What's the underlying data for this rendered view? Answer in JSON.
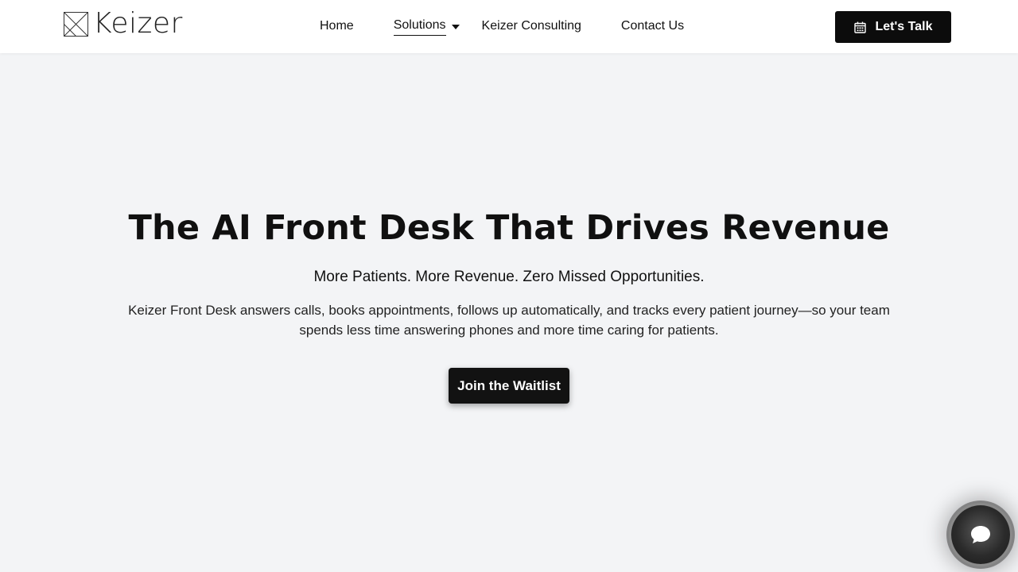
{
  "header": {
    "logo_text": "Keizer",
    "nav": {
      "home": "Home",
      "solutions": "Solutions",
      "consulting": "Keizer Consulting",
      "contact": "Contact Us"
    },
    "cta_label": "Let's Talk"
  },
  "hero": {
    "title": "The AI Front Desk That Drives Revenue",
    "subtitle": "More Patients. More Revenue. Zero Missed Opportunities.",
    "body": "Keizer Front Desk answers calls, books appointments, follows up automatically, and tracks every patient journey—so your team spends less time answering phones and more time caring for patients.",
    "button_label": "Join the Waitlist"
  },
  "icons": {
    "logo": "keizer-logo-mark",
    "dropdown": "chevron-down-icon",
    "calendar": "calendar-icon",
    "chat": "chat-bubble-icon"
  },
  "colors": {
    "background": "#f3f4f6",
    "header_bg": "#ffffff",
    "button_bg": "#0c0c0c",
    "text": "#111111"
  }
}
